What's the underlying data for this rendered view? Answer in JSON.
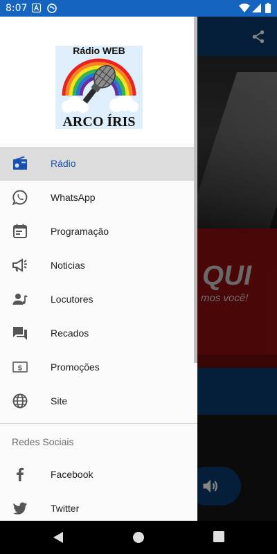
{
  "status_bar": {
    "time": "8:07",
    "background": "#1565c0"
  },
  "background_app": {
    "overlay_text_big": "QUI",
    "overlay_text_small": "mos você!"
  },
  "drawer": {
    "logo": {
      "line1": "Rádio WEB",
      "line2": "ARCO ÍRIS"
    },
    "items": [
      {
        "label": "Rádio",
        "icon": "radio-icon",
        "active": true
      },
      {
        "label": "WhatsApp",
        "icon": "whatsapp-icon",
        "active": false
      },
      {
        "label": "Programação",
        "icon": "calendar-icon",
        "active": false
      },
      {
        "label": "Noticias",
        "icon": "megaphone-icon",
        "active": false
      },
      {
        "label": "Locutores",
        "icon": "speaker-person-icon",
        "active": false
      },
      {
        "label": "Recados",
        "icon": "messages-icon",
        "active": false
      },
      {
        "label": "Promoções",
        "icon": "money-icon",
        "active": false
      },
      {
        "label": "Site",
        "icon": "globe-icon",
        "active": false
      }
    ],
    "section_title": "Redes Sociais",
    "social_items": [
      {
        "label": "Facebook",
        "icon": "facebook-icon"
      },
      {
        "label": "Twitter",
        "icon": "twitter-icon"
      }
    ],
    "accent_color": "#1650b3"
  }
}
